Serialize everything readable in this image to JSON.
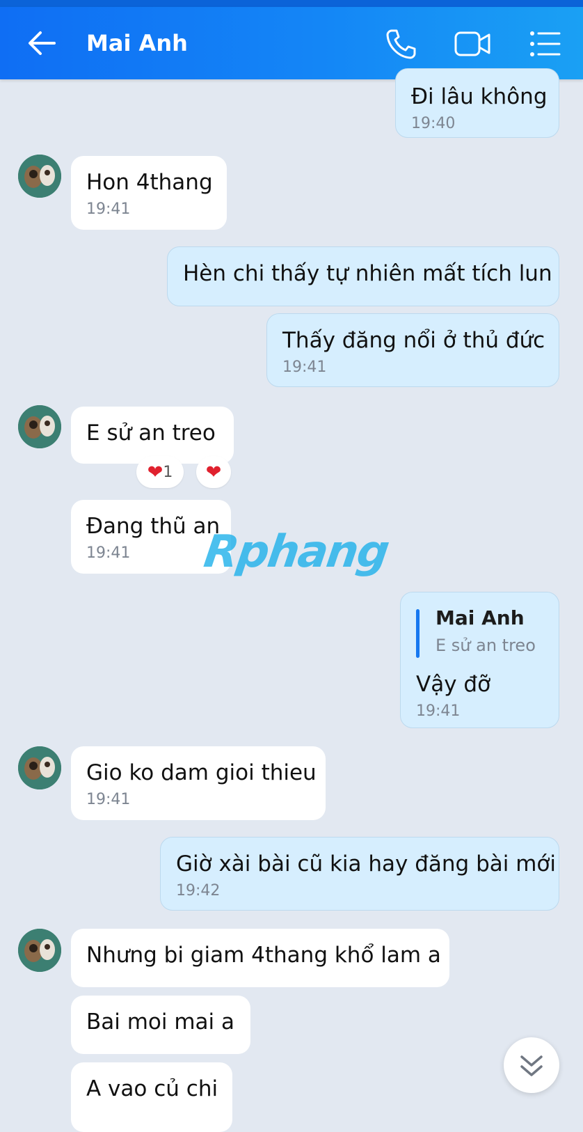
{
  "header": {
    "title": "Mai Anh",
    "icons": [
      "back-arrow-icon",
      "phone-icon",
      "video-call-icon",
      "menu-list-icon"
    ]
  },
  "colors": {
    "header": "#1486f6",
    "incoming_bubble": "#ffffff",
    "outgoing_bubble": "#d6eefe",
    "background": "#e2e8f1",
    "reaction_heart": "#e0212e"
  },
  "messages": [
    {
      "side": "out",
      "text": "Đi lâu không",
      "time": "19:40"
    },
    {
      "side": "in",
      "text": "Hon 4thang",
      "time": "19:41"
    },
    {
      "side": "out",
      "text": "Hèn chi thấy tự nhiên mất tích lun"
    },
    {
      "side": "out",
      "text": "Thấy đăng nổi ở thủ đức",
      "time": "19:41"
    },
    {
      "side": "in",
      "text": "E sử an treo",
      "reactions": {
        "count": "1"
      }
    },
    {
      "side": "in",
      "text": "Đang thũ an",
      "time": "19:41"
    },
    {
      "side": "out",
      "reply": {
        "name": "Mai Anh",
        "text": "E sử an treo"
      },
      "text": "Vậy đỡ",
      "time": "19:41"
    },
    {
      "side": "in",
      "text": "Gio ko dam gioi thieu",
      "time": "19:41"
    },
    {
      "side": "out",
      "text": "Giờ xài bài cũ kia hay đăng bài mới",
      "time": "19:42"
    },
    {
      "side": "in",
      "text": "Nhưng bi giam 4thang khổ lam a"
    },
    {
      "side": "in",
      "text": "Bai moi mai a"
    },
    {
      "side": "in",
      "text": "A vao củ chi"
    }
  ],
  "watermark": "Rphang"
}
